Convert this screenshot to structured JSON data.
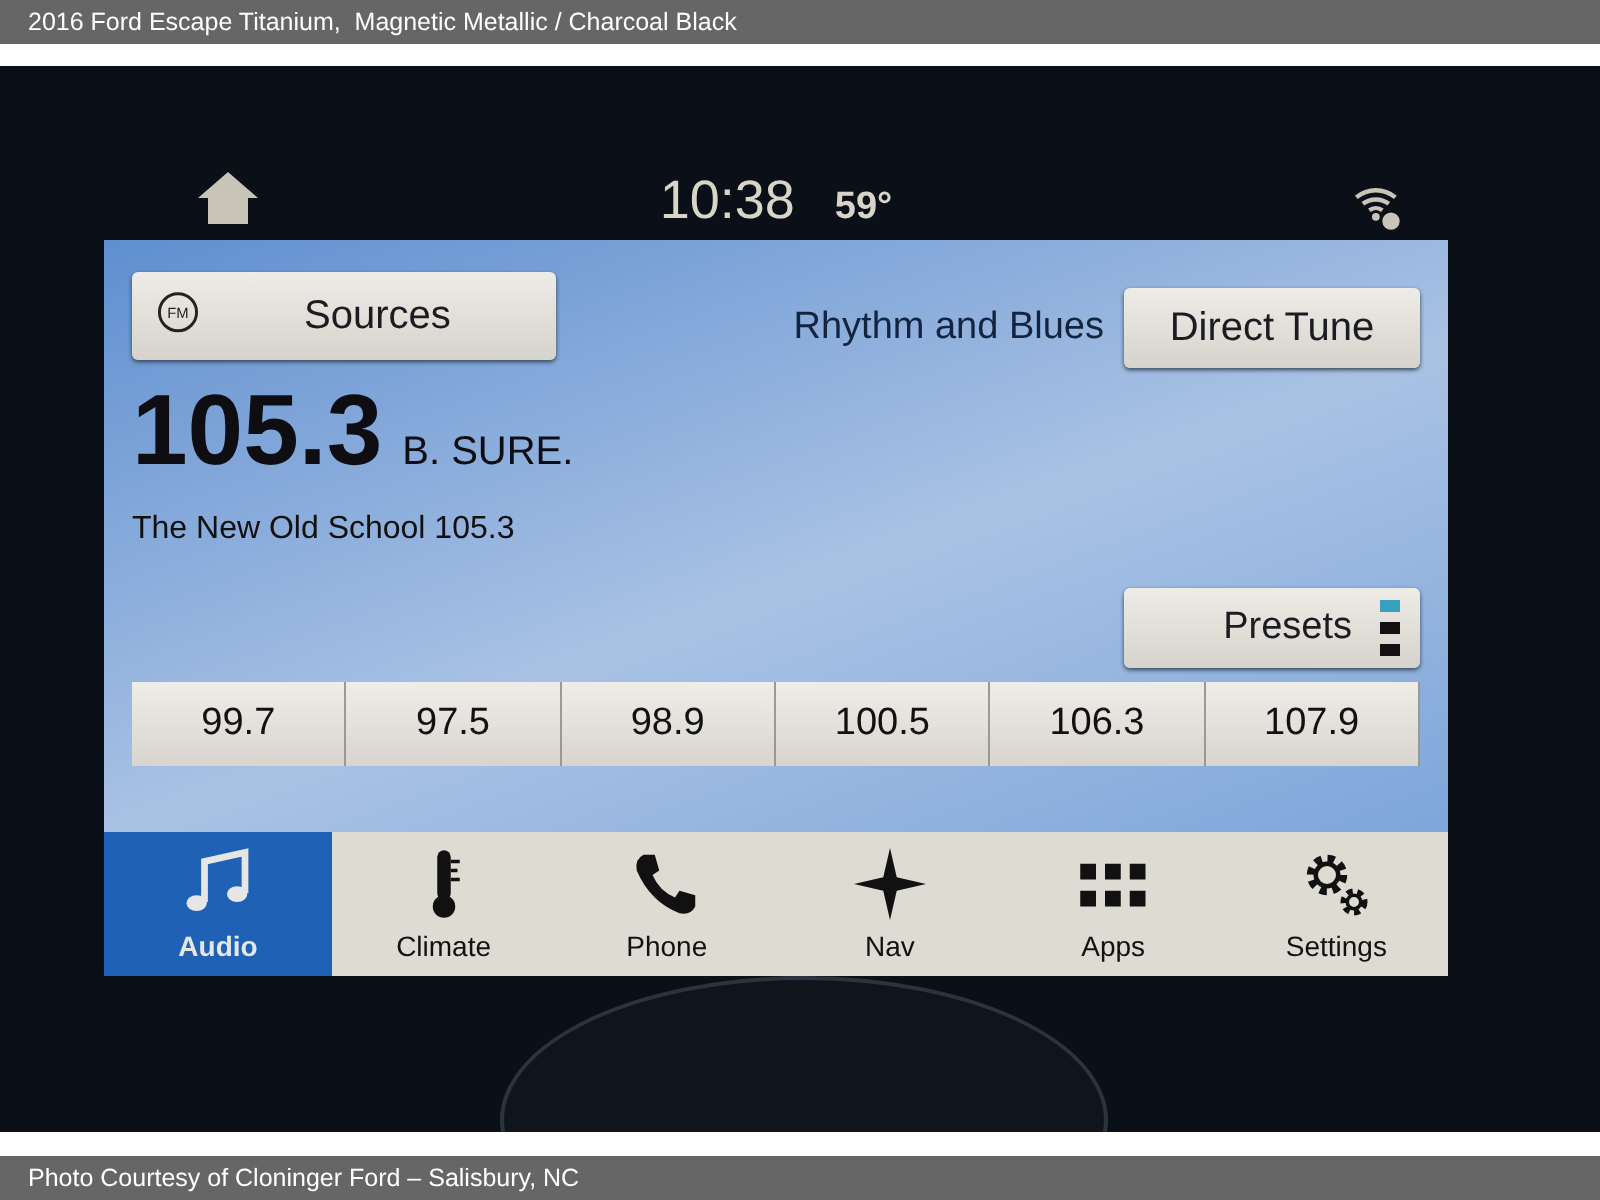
{
  "caption": "2016 Ford Escape Titanium,  Magnetic Metallic / Charcoal Black",
  "status_bar": {
    "time": "10:38",
    "temperature": "59°"
  },
  "radio": {
    "band": "FM",
    "sources_button": "Sources",
    "genre": "Rhythm and Blues",
    "direct_tune_button": "Direct Tune",
    "frequency": "105.3",
    "station_name": "B. SURE.",
    "program": "The New Old School 105.3",
    "presets_button": "Presets",
    "presets": [
      {
        "label": "99.7"
      },
      {
        "label": "97.5"
      },
      {
        "label": "98.9"
      },
      {
        "label": "100.5"
      },
      {
        "label": "106.3"
      },
      {
        "label": "107.9"
      }
    ]
  },
  "nav": [
    {
      "label": "Audio",
      "kind": "audio",
      "selected": true
    },
    {
      "label": "Climate",
      "kind": "climate",
      "selected": false
    },
    {
      "label": "Phone",
      "kind": "phone",
      "selected": false
    },
    {
      "label": "Nav",
      "kind": "nav",
      "selected": false
    },
    {
      "label": "Apps",
      "kind": "apps",
      "selected": false
    },
    {
      "label": "Settings",
      "kind": "settings",
      "selected": false
    }
  ],
  "credit": "Photo Courtesy of Cloninger Ford – Salisbury, NC"
}
